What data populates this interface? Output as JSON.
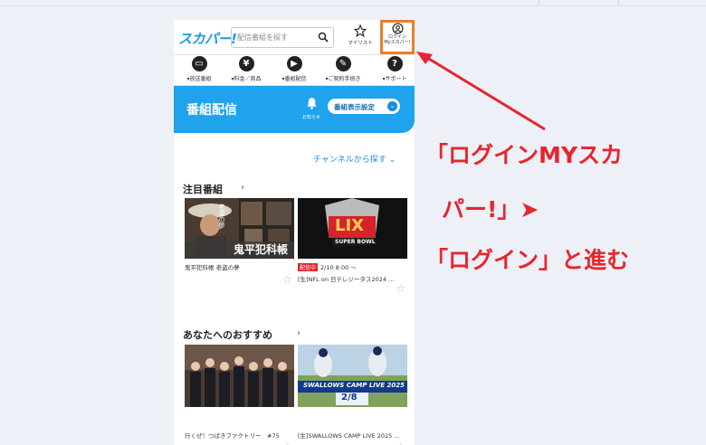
{
  "header": {
    "logo": "スカパー!",
    "search_placeholder": "配信番組を探す",
    "mylist_label": "マイリスト",
    "login_label_1": "ログイン",
    "login_label_2": "Myスカパー!"
  },
  "nav": [
    {
      "label": "▾放送番組",
      "icon": "tv-icon"
    },
    {
      "label": "▾料金／商品",
      "icon": "yen-icon"
    },
    {
      "label": "▾番組配信",
      "icon": "play-icon"
    },
    {
      "label": "▾ご契約手続き",
      "icon": "pen-icon"
    },
    {
      "label": "▾サポート",
      "icon": "question-icon"
    }
  ],
  "banner": {
    "title": "番組配信",
    "bell_label": "お知らせ",
    "setting_label": "番組表示設定"
  },
  "channel_link": "チャンネルから探す ⌄",
  "sections": [
    {
      "title": "注目番組",
      "cards": [
        {
          "caption": "鬼平犯科帳 老盗の夢",
          "thumb_text": "鬼平犯科帳",
          "thumb_sub": "老盗の夢"
        },
        {
          "caption": "2/10 8:00 ～",
          "caption2": "[生]NFL on 日テレジータス2024 ...",
          "live": "配信中",
          "thumb_text": "LIX",
          "thumb_sub": "SUPER BOWL"
        }
      ]
    },
    {
      "title": "あなたへのおすすめ",
      "cards": [
        {
          "caption": "行くぜ！つばきファクトリー　#75"
        },
        {
          "caption": "[生]SWALLOWS CAMP LIVE 2025 ...",
          "thumb_text": "SWALLOWS CAMP LIVE 2025",
          "thumb_sub": "2/8"
        }
      ]
    }
  ],
  "annotation": {
    "line1": "「ログインMYスカ",
    "line2": "パー!」➤",
    "line3": "「ログイン」と進む"
  },
  "colors": {
    "accent": "#1ea3ec",
    "highlight": "#f07d25",
    "annotation": "#e8252f"
  }
}
